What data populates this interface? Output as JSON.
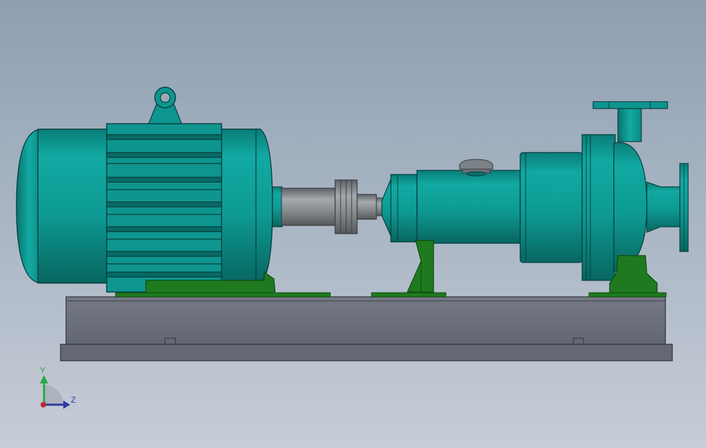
{
  "viewport": {
    "background_top": "#8e9fb2",
    "background_bottom": "#c3cbd6"
  },
  "colors": {
    "teal": "#0f9c96",
    "teal_dark": "#0a6e6a",
    "teal_outline": "#063f3c",
    "green": "#1f7a1f",
    "green_dark": "#0e4a0e",
    "base_gray": "#6c717b",
    "base_gray_dark": "#3b3f46",
    "shaft_gray": "#8d9296"
  },
  "triad": {
    "y_label": "Y",
    "z_label": "Z",
    "y_color": "#2aa84a",
    "z_color": "#2a3aa0",
    "x_color": "#c0282a"
  }
}
